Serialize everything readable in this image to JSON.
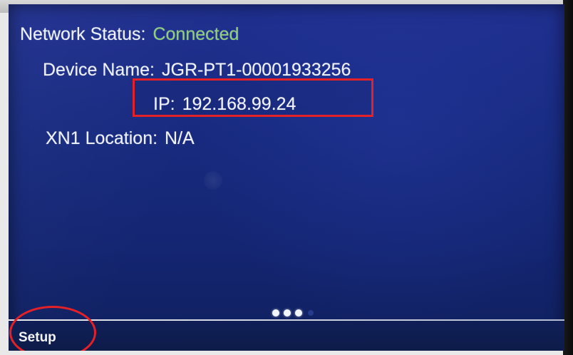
{
  "network_status": {
    "label": "Network Status:",
    "value": "Connected",
    "value_color": "#8fd07a"
  },
  "device_name": {
    "label": "Device Name:",
    "value": "JGR-PT1-00001933256"
  },
  "ip": {
    "label": "IP:",
    "value": "192.168.99.24"
  },
  "xn1_location": {
    "label": "XN1 Location:",
    "value": "N/A"
  },
  "page_indicator": {
    "active_dots": 3,
    "total_dots": 4
  },
  "bottom_bar": {
    "setup_label": "Setup"
  },
  "annotations": {
    "highlight_color": "#e32127"
  }
}
